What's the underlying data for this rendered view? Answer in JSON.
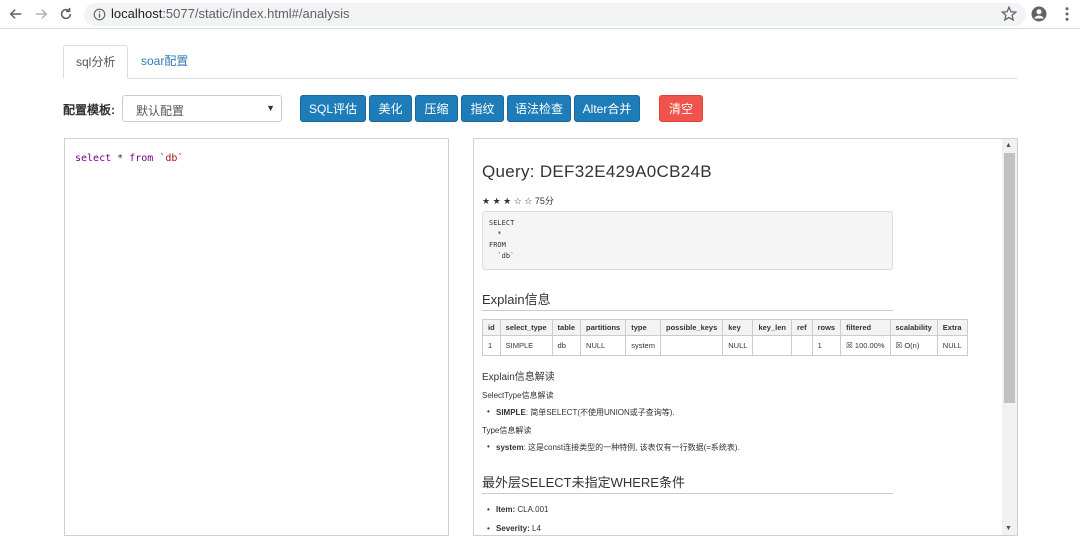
{
  "browser": {
    "url_host": "localhost",
    "url_rest": ":5077/static/index.html#/analysis"
  },
  "tabs": [
    {
      "label": "sql分析",
      "active": true
    },
    {
      "label": "soar配置",
      "active": false
    }
  ],
  "toolbar": {
    "template_label": "配置模板:",
    "template_value": "默认配置",
    "buttons": [
      "SQL评估",
      "美化",
      "压缩",
      "指纹",
      "语法检查",
      "Alter合并"
    ],
    "clear_label": "清空",
    "accent_color": "#1e7db8",
    "danger_color": "#f0534c"
  },
  "editor": {
    "kw_select": "select",
    "op_star": "*",
    "kw_from": "from",
    "table": "`db`"
  },
  "result": {
    "query_title": "Query: DEF32E429A0CB24B",
    "score": "★ ★ ★ ☆ ☆ 75分",
    "sql_formatted": "SELECT\n  *\nFROM\n  `db`",
    "explain_heading": "Explain信息",
    "explain_columns": [
      "id",
      "select_type",
      "table",
      "partitions",
      "type",
      "possible_keys",
      "key",
      "key_len",
      "ref",
      "rows",
      "filtered",
      "scalability",
      "Extra"
    ],
    "explain_row": [
      "1",
      "SIMPLE",
      "db",
      "NULL",
      "system",
      "",
      "NULL",
      "",
      "",
      "1",
      "☒ 100.00%",
      "☒ O(n)",
      "NULL"
    ],
    "explain_interp_heading": "Explain信息解读",
    "select_type_heading": "SelectType信息解读",
    "select_type_term": "SIMPLE",
    "select_type_desc": ": 简单SELECT(不使用UNION或子查询等).",
    "type_heading": "Type信息解读",
    "type_term": "system",
    "type_desc": ": 这是const连接类型的一种特例, 该表仅有一行数据(=系统表).",
    "rule_heading": "最外层SELECT未指定WHERE条件",
    "item_label": "Item:",
    "item_value": "CLA.001",
    "severity_label": "Severity:",
    "severity_value": "L4"
  }
}
